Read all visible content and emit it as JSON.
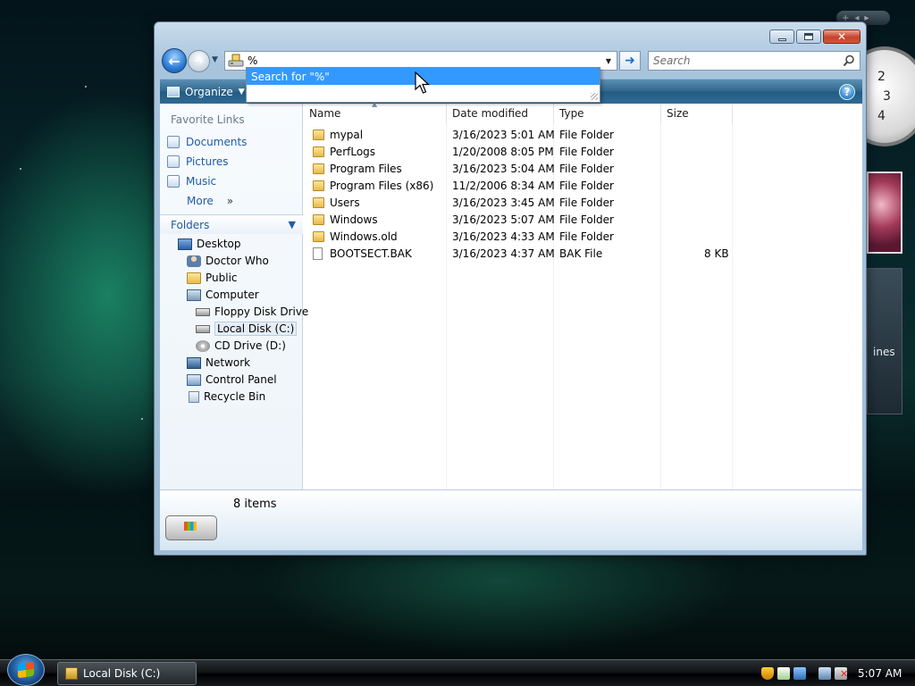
{
  "desktop": {
    "gadget_feed_text": "ines",
    "clock_numbers": [
      "2",
      "3",
      "4"
    ],
    "gadget_controls": [
      "+",
      "◂",
      "▸"
    ]
  },
  "window": {
    "address": {
      "value": "%"
    },
    "search": {
      "placeholder": "Search"
    },
    "autocomplete": {
      "item": "Search for \"%\""
    },
    "toolbar": {
      "organize": "Organize",
      "help": "?"
    },
    "favorite_links": {
      "title": "Favorite Links",
      "items": [
        "Documents",
        "Pictures",
        "Music",
        "More"
      ]
    },
    "folders": {
      "title": "Folders",
      "tree": [
        {
          "label": "Desktop",
          "icon": "desktop-icon"
        },
        {
          "label": "Doctor Who",
          "icon": "user-folder-icon"
        },
        {
          "label": "Public",
          "icon": "folder-icon"
        },
        {
          "label": "Computer",
          "icon": "computer-icon"
        },
        {
          "label": "Floppy Disk Drive",
          "icon": "floppy-drive-icon"
        },
        {
          "label": "Local Disk (C:)",
          "icon": "hard-drive-icon",
          "selected": true
        },
        {
          "label": "CD Drive (D:)",
          "icon": "cd-drive-icon"
        },
        {
          "label": "Network",
          "icon": "network-icon"
        },
        {
          "label": "Control Panel",
          "icon": "control-panel-icon"
        },
        {
          "label": "Recycle Bin",
          "icon": "recycle-bin-icon"
        }
      ]
    },
    "columns": [
      "Name",
      "Date modified",
      "Type",
      "Size"
    ],
    "files": [
      {
        "name": "mypal",
        "date": "3/16/2023 5:01 AM",
        "type": "File Folder",
        "size": ""
      },
      {
        "name": "PerfLogs",
        "date": "1/20/2008 8:05 PM",
        "type": "File Folder",
        "size": ""
      },
      {
        "name": "Program Files",
        "date": "3/16/2023 5:04 AM",
        "type": "File Folder",
        "size": ""
      },
      {
        "name": "Program Files (x86)",
        "date": "11/2/2006 8:34 AM",
        "type": "File Folder",
        "size": ""
      },
      {
        "name": "Users",
        "date": "3/16/2023 3:45 AM",
        "type": "File Folder",
        "size": ""
      },
      {
        "name": "Windows",
        "date": "3/16/2023 5:07 AM",
        "type": "File Folder",
        "size": ""
      },
      {
        "name": "Windows.old",
        "date": "3/16/2023 4:33 AM",
        "type": "File Folder",
        "size": ""
      },
      {
        "name": "BOOTSECT.BAK",
        "date": "3/16/2023 4:37 AM",
        "type": "BAK File",
        "size": "8 KB"
      }
    ],
    "details": {
      "count_text": "8 items"
    }
  },
  "taskbar": {
    "window_button": "Local Disk (C:)",
    "clock": "5:07 AM",
    "tray_icons": [
      "shield-icon",
      "security-center-icon",
      "network-tray-icon",
      "display-tray-icon",
      "volume-muted-icon"
    ]
  },
  "colors": {
    "selection_blue": "#3399ff",
    "link_blue": "#1f5aa5",
    "toolbar_teal": "#2e6b95"
  }
}
